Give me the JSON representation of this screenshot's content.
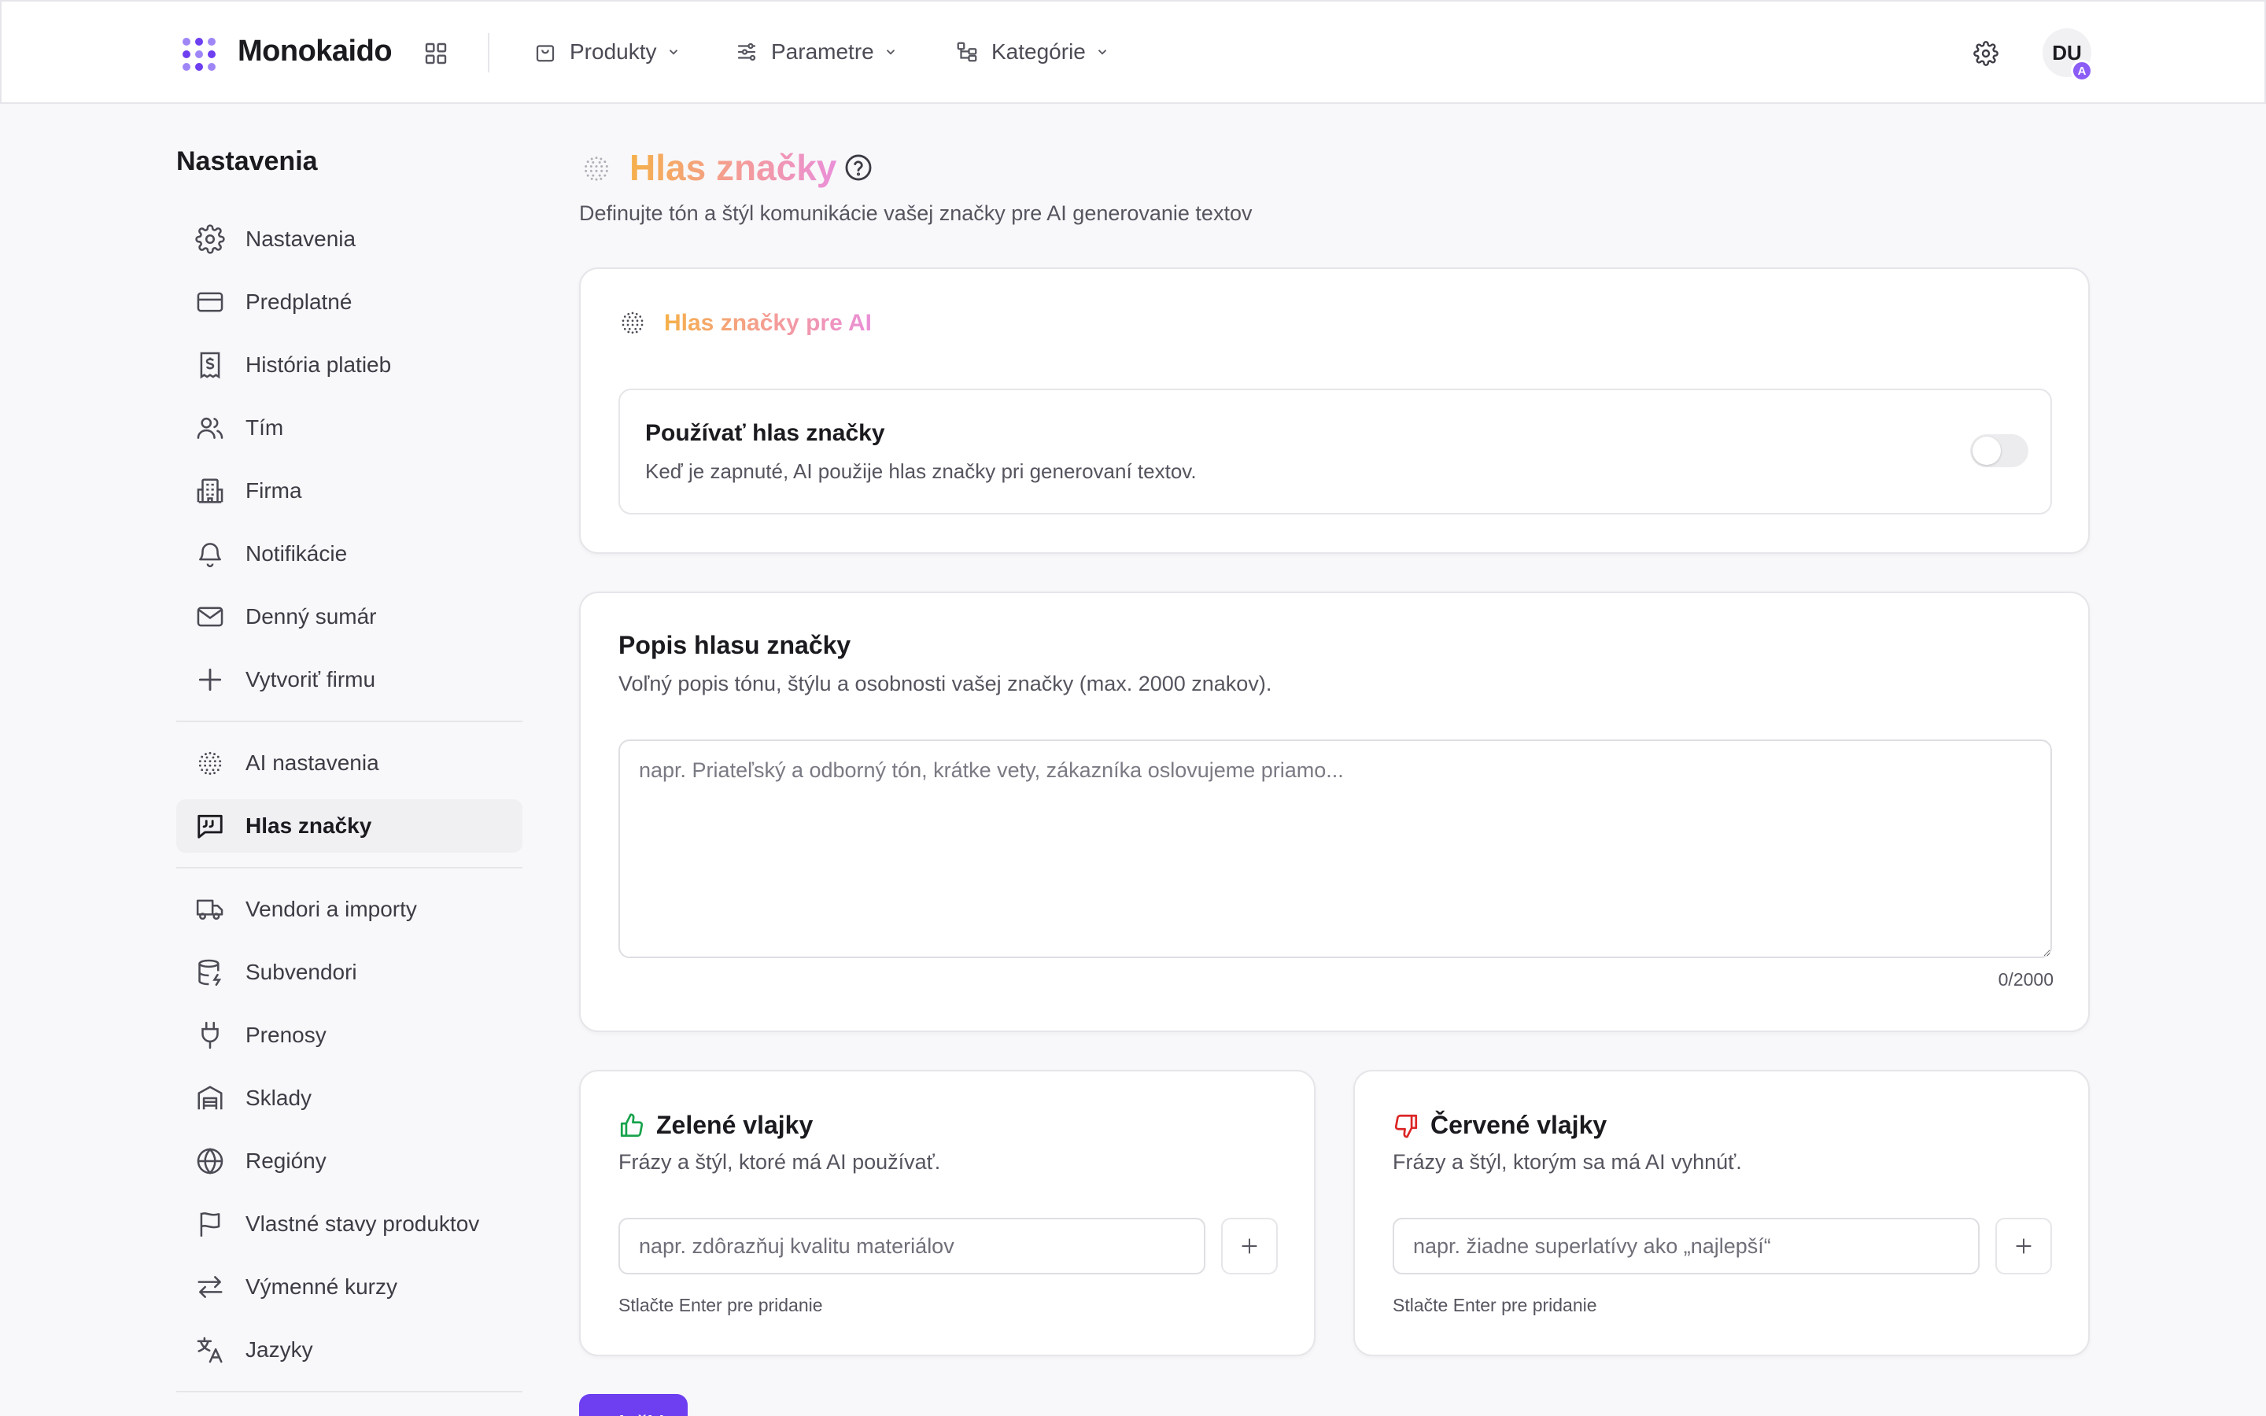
{
  "header": {
    "brand": "Monokaido",
    "nav": [
      {
        "label": "Produkty",
        "icon": "shopping-bag-icon"
      },
      {
        "label": "Parametre",
        "icon": "sliders-icon"
      },
      {
        "label": "Kategórie",
        "icon": "category-tree-icon"
      }
    ],
    "avatar_initials": "DU",
    "avatar_badge": "A"
  },
  "sidebar": {
    "title": "Nastavenia",
    "items": [
      {
        "label": "Nastavenia",
        "icon": "gear-icon"
      },
      {
        "label": "Predplatné",
        "icon": "credit-card-icon"
      },
      {
        "label": "História platieb",
        "icon": "receipt-icon"
      },
      {
        "label": "Tím",
        "icon": "users-icon"
      },
      {
        "label": "Firma",
        "icon": "building-icon"
      },
      {
        "label": "Notifikácie",
        "icon": "bell-icon"
      },
      {
        "label": "Denný sumár",
        "icon": "mail-icon"
      },
      {
        "label": "Vytvoriť firmu",
        "icon": "plus-icon"
      },
      {
        "label": "AI nastavenia",
        "icon": "ai-sphere-icon"
      },
      {
        "label": "Hlas značky",
        "icon": "quote-message-icon",
        "active": true
      },
      {
        "label": "Vendori a importy",
        "icon": "truck-icon"
      },
      {
        "label": "Subvendori",
        "icon": "database-icon"
      },
      {
        "label": "Prenosy",
        "icon": "plug-icon"
      },
      {
        "label": "Sklady",
        "icon": "warehouse-icon"
      },
      {
        "label": "Regióny",
        "icon": "globe-icon"
      },
      {
        "label": "Vlastné stavy produktov",
        "icon": "flag-icon"
      },
      {
        "label": "Výmenné kurzy",
        "icon": "exchange-arrows-icon"
      },
      {
        "label": "Jazyky",
        "icon": "translate-icon"
      }
    ]
  },
  "page": {
    "title": "Hlas značky",
    "subtitle": "Definujte tón a štýl komunikácie vašej značky pre AI generovanie textov"
  },
  "ai_card": {
    "title": "Hlas značky pre AI",
    "toggle_title": "Používať hlas značky",
    "toggle_desc": "Keď je zapnuté, AI použije hlas značky pri generovaní textov.",
    "toggle_on": false
  },
  "description_card": {
    "title": "Popis hlasu značky",
    "desc": "Voľný popis tónu, štýlu a osobnosti vašej značky (max. 2000 znakov).",
    "placeholder": "napr. Priateľský a odborný tón, krátke vety, zákazníka oslovujeme priamo...",
    "value": "",
    "counter": "0/2000"
  },
  "green_flags": {
    "title": "Zelené vlajky",
    "desc": "Frázy a štýl, ktoré má AI používať.",
    "placeholder": "napr. zdôrazňuj kvalitu materiálov",
    "hint": "Stlačte Enter pre pridanie",
    "color": "#16a34a"
  },
  "red_flags": {
    "title": "Červené vlajky",
    "desc": "Frázy a štýl, ktorým sa má AI vyhnúť.",
    "placeholder": "napr. žiadne superlatívy ako „najlepší“",
    "hint": "Stlačte Enter pre pridanie",
    "color": "#dc2626"
  },
  "save_label": "Uložiť",
  "colors": {
    "accent": "#6d3ff0",
    "title_gradient": [
      "#f5b04a",
      "#f49b9b",
      "#ea8fd9"
    ]
  }
}
